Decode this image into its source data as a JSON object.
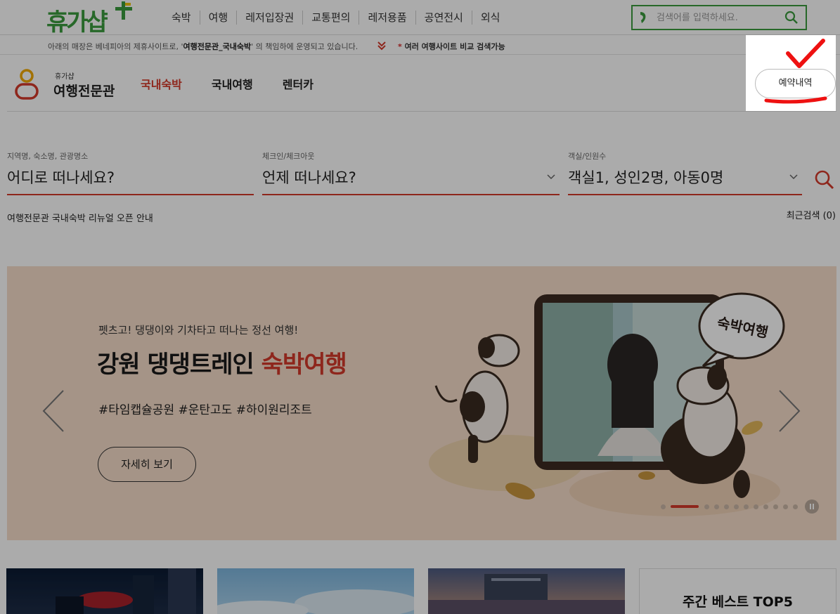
{
  "topbar": {
    "logo_text": "휴가샵",
    "nav": [
      "숙박",
      "여행",
      "레저입장권",
      "교통편의",
      "레저용품",
      "공연전시",
      "외식"
    ],
    "search_placeholder": "검색어를 입력하세요."
  },
  "notice": {
    "prefix": "아래의 매장은 베네피아의 제휴사이트로, '",
    "bold": "여행전문관_국내숙박",
    "suffix": "' 의 책임하에 운영되고 있습니다.",
    "compare_star": "*",
    "compare": " 여러 여행사이트 비교 검색가능"
  },
  "header": {
    "brand_small": "휴가샵",
    "brand_big": "여행전문관",
    "tabs": [
      {
        "label": "국내숙박",
        "active": true
      },
      {
        "label": "국내여행",
        "active": false
      },
      {
        "label": "렌터카",
        "active": false
      }
    ],
    "reservation_button": "예약내역"
  },
  "search": {
    "destination": {
      "label": "지역명, 숙소명, 관광명소",
      "value": "어디로 떠나세요?"
    },
    "dates": {
      "label": "체크인/체크아웃",
      "value": "언제 떠나세요?"
    },
    "guests": {
      "label": "객실/인원수",
      "value": "객실1, 성인2명, 아동0명"
    },
    "renewal_notice": "여행전문관 국내숙박 리뉴얼 오픈 안내",
    "recent": "최근검색 (0)"
  },
  "banner": {
    "subtitle": "펫츠고! 댕댕이와 기차타고 떠나는 정선 여행!",
    "title_black": "강원 댕댕트레인 ",
    "title_red": "숙박여행",
    "tags": "#타임캡슐공원 #운탄고도 #하이원리조트",
    "more_button": "자세히 보기",
    "bubble_text": "숙박여행",
    "slide_index": 2,
    "slide_count": 13
  },
  "best": {
    "title": "주간 베스트 TOP5"
  },
  "colors": {
    "brand_green": "#3b9b3e",
    "accent_red": "#d43a2a",
    "banner_bg": "#f6ddc9"
  }
}
